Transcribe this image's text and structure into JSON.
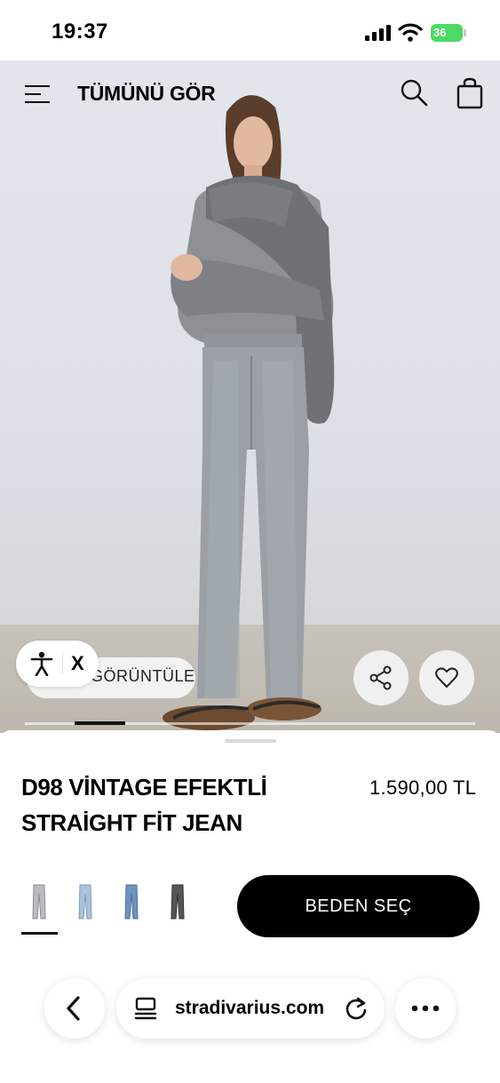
{
  "status_bar": {
    "time": "19:37",
    "battery_level": "36"
  },
  "header": {
    "see_all": "TÜMÜNÜ GÖR",
    "icons": [
      "menu-icon",
      "search-icon",
      "shopping-bag-icon"
    ]
  },
  "hero": {
    "image_subject": "model wearing grey jeans, grey sweater and scarf",
    "view_label": "GÖRÜNTÜLE",
    "accessibility_close": "X",
    "icons": [
      "accessibility-icon",
      "share-icon",
      "heart-icon"
    ],
    "active_image_index": 1
  },
  "product": {
    "title": "D98 VİNTAGE EFEKTLİ STRAİGHT FİT JEAN",
    "price": "1.590,00 TL",
    "swatches": [
      {
        "color": "#b9bcc2",
        "selected": true
      },
      {
        "color": "#a9c3dd",
        "selected": false
      },
      {
        "color": "#6f93c0",
        "selected": false
      },
      {
        "color": "#555659",
        "selected": false
      }
    ],
    "size_button": "BEDEN SEÇ"
  },
  "browser": {
    "url": "stradivarius.com",
    "icons": [
      "back-icon",
      "reader-icon",
      "reload-icon",
      "more-icon"
    ]
  }
}
